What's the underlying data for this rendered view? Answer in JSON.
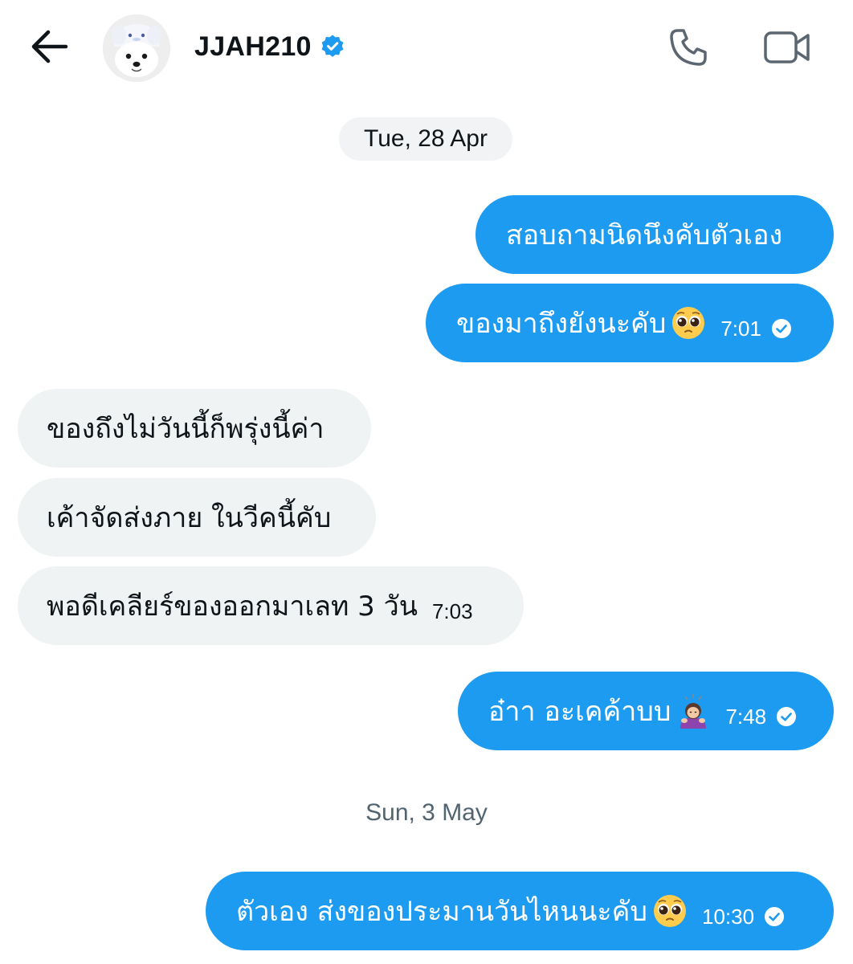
{
  "header": {
    "back_label": "back",
    "title": "JJAH210",
    "icons": [
      "arrow-left-icon",
      "avatar",
      "verified-badge-icon",
      "phone-icon",
      "video-icon"
    ]
  },
  "colors": {
    "outgoing_bubble": "#1d9bf0",
    "incoming_bubble": "#eff3f4",
    "verified": "#1d9bf0",
    "date_chip": "#f1f3f4",
    "muted_text": "#536471"
  },
  "conversation": {
    "date_1": "Tue, 28 Apr",
    "date_2": "Sun, 3 May",
    "messages": [
      {
        "direction": "outgoing",
        "text": "สอบถามนิดนึงคับตัวเอง",
        "time": ""
      },
      {
        "direction": "outgoing",
        "text": "ของมาถึงยังนะคับ",
        "emoji": "pleading-face-icon",
        "time": "7:01",
        "status": "sent"
      },
      {
        "direction": "incoming",
        "text": "ของถึงไม่วันนี้ก็พรุ่งนี้ค่า",
        "time": ""
      },
      {
        "direction": "incoming",
        "text": "เค้าจัดส่งภาย ในวีคนี้คับ",
        "time": ""
      },
      {
        "direction": "incoming",
        "text": "พอดีเคลียร์ของออกมาเลท 3 วัน",
        "time": "7:03"
      },
      {
        "direction": "outgoing",
        "text": "อ๋าา อะเคค้าบบ",
        "emoji": "person-bowing-icon",
        "time": "7:48",
        "status": "sent"
      },
      {
        "direction": "outgoing",
        "text": "ตัวเอง ส่งของประมานวันไหนนะคับ",
        "emoji": "pleading-face-icon",
        "time": "10:30",
        "status": "sent"
      }
    ]
  }
}
